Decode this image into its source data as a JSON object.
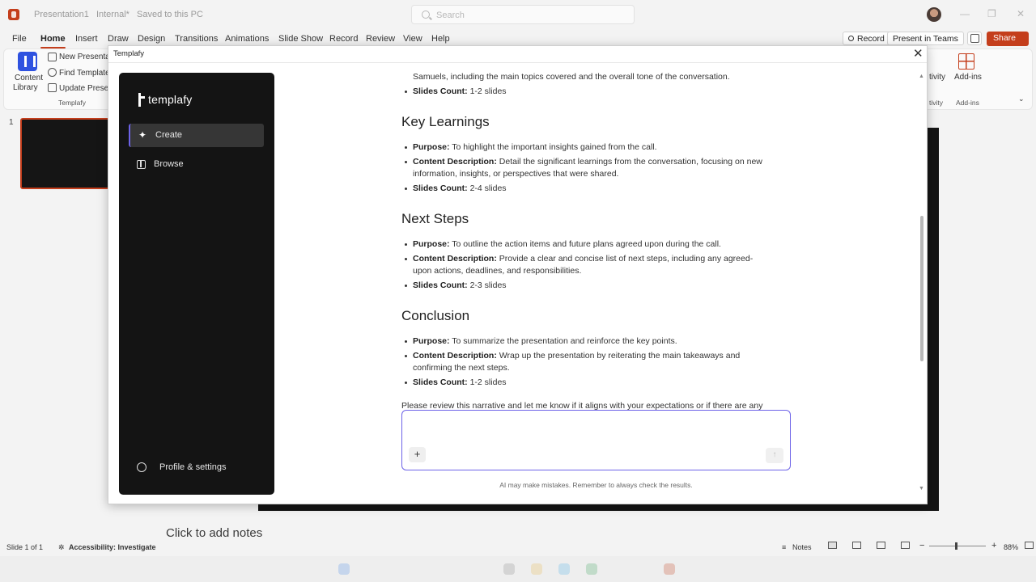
{
  "window": {
    "doc_name": "Presentation1",
    "sensitivity": "Internal*",
    "save_status": "Saved to this PC",
    "search_placeholder": "Search",
    "minimize": "—",
    "restore": "❐",
    "close": "✕"
  },
  "menu": {
    "tabs": [
      "File",
      "Home",
      "Insert",
      "Draw",
      "Design",
      "Transitions",
      "Animations",
      "Slide Show",
      "Record",
      "Review",
      "View",
      "Help"
    ],
    "active_tab": "Home",
    "record_label": "Record",
    "present_label": "Present in Teams",
    "share_label": "Share"
  },
  "ribbon": {
    "content_library": "Content",
    "content_library_2": "Library",
    "new_presentation": "New Presentation",
    "find_template": "Find Template",
    "update_presentation": "Update Presentation",
    "group_label": "Templafy",
    "activity_label": "tivity",
    "activity_group": "tivity",
    "addins_label": "Add-ins",
    "addins_group": "Add-ins"
  },
  "slides": {
    "number": "1"
  },
  "dialog": {
    "title": "Templafy",
    "close": "✕"
  },
  "templafy": {
    "logo": "templafy",
    "nav": [
      {
        "label": "Create"
      },
      {
        "label": "Browse"
      }
    ],
    "profile": "Profile & settings"
  },
  "chat": {
    "intro_line1": "Samuels, including the main topics covered and the overall tone of the conversation.",
    "intro_count_label": "Slides Count:",
    "intro_count": "1-2 slides",
    "sections": [
      {
        "heading": "Key Learnings",
        "purpose_label": "Purpose:",
        "purpose": "To highlight the important insights gained from the call.",
        "content_label": "Content Description:",
        "content_1": "Detail the significant learnings from the conversation, focusing on new",
        "content_2": "information, insights, or perspectives that were shared.",
        "count_label": "Slides Count:",
        "count": "2-4 slides"
      },
      {
        "heading": "Next Steps",
        "purpose_label": "Purpose:",
        "purpose": "To outline the action items and future plans agreed upon during the call.",
        "content_label": "Content Description:",
        "content_1": "Provide a clear and concise list of next steps, including any agreed-",
        "content_2": "upon actions, deadlines, and responsibilities.",
        "count_label": "Slides Count:",
        "count": "2-3 slides"
      },
      {
        "heading": "Conclusion",
        "purpose_label": "Purpose:",
        "purpose": "To summarize the presentation and reinforce the key points.",
        "content_label": "Content Description:",
        "content_1": "Wrap up the presentation by reiterating the main takeaways and",
        "content_2": "confirming the next steps.",
        "count_label": "Slides Count:",
        "count": "1-2 slides"
      }
    ],
    "review_text": "Please review this narrative and let me know if it aligns with your expectations or if there are any",
    "plus": "+",
    "send": "↑",
    "disclaimer": "AI may make mistakes. Remember to always check the results."
  },
  "notes": {
    "placeholder": "Click to add notes"
  },
  "status": {
    "slide_info": "Slide 1 of 1",
    "accessibility": "Accessibility: Investigate",
    "notes": "Notes",
    "zoom_minus": "−",
    "zoom_plus": "+",
    "zoom": "88%"
  }
}
